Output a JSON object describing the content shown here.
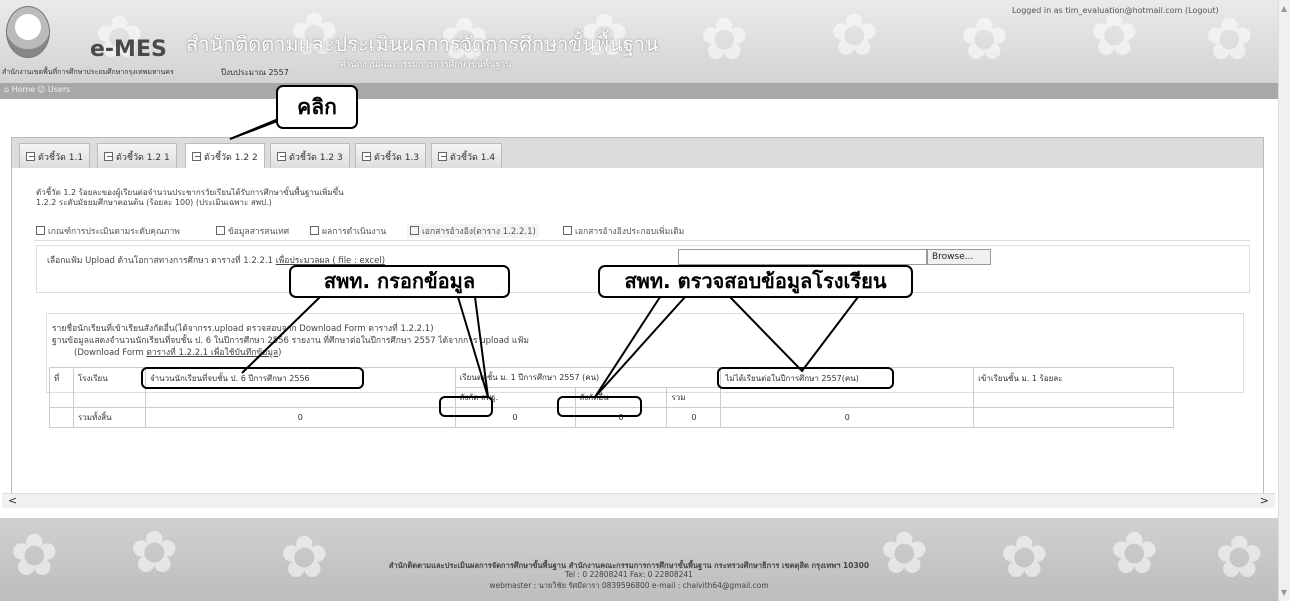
{
  "header": {
    "logo_text": "e-MES",
    "office_title": "สำนักติดตามและประเมินผลการจัดการศึกษาขั้นพื้นฐาน",
    "office_subtitle": "สำนักงานคณะกรรมการการศึกษาขั้นพื้นฐาน",
    "agency": "สำนักงานเขตพื้นที่การศึกษาประถมศึกษากรุงเทพมหานคร",
    "budget_year": "ปีงบประมาณ 2557",
    "logged_in": "Logged in as tim_evaluation@hotmail.com (Logout)"
  },
  "nav": {
    "home": "Home",
    "users": "Users"
  },
  "tabs": [
    "ตัวชี้วัด 1.1",
    "ตัวชี้วัด 1.2 1",
    "ตัวชี้วัด 1.2 2",
    "ตัวชี้วัด 1.2 3",
    "ตัวชี้วัด 1.3",
    "ตัวชี้วัด 1.4"
  ],
  "indicator": {
    "line1": "ตัวชี้วัด 1.2 ร้อยละของผู้เรียนต่อจำนวนประชากรวัยเรียนได้รับการศึกษาขั้นพื้นฐานเพิ่มขึ้น",
    "line2": "1.2.2 ระดับมัธยมศึกษาตอนต้น (ร้อยละ 100) (ประเมินเฉพาะ สพป.)"
  },
  "subtabs": [
    "เกณฑ์การประเมินตามระดับคุณภาพ",
    "ข้อมูลสารสนเทศ",
    "ผลการดำเนินงาน",
    "เอกสารอ้างอิง(ตาราง 1.2.2.1)",
    "เอกสารอ้างอิงประกอบเพิ่มเติม"
  ],
  "upload": {
    "label": "เลือกแฟ้ม Upload ด้านโอกาสทางการศึกษา ตารางที่ 1.2.2.1",
    "link": "เพื่อประมวลผล ( file : excel)",
    "browse": "Browse..."
  },
  "info": {
    "line1": "รายชื่อนักเรียนที่เข้าเรียนสังกัดอื่น(ได้จากรร.upload ตรวจสอบจาก Download Form ตารางที่ 1.2.2.1)",
    "line2": "ฐานข้อมูลแสดงจำนวนนักเรียนที่จบชั้น ป. 6 ในปีการศึกษา 2556 รายงาน ที่ศึกษาต่อในปีการศึกษา 2557 ได้จากการ upload แฟ้ม",
    "line3_prefix": "(Download Form ",
    "line3_link": "ตารางที่ 1.2.2.1 เพื่อใช้บันทึกข้อมูล",
    "line3_suffix": ")"
  },
  "table": {
    "h_no": "ที่",
    "h_school": "โรงเรียน",
    "h_grad": "จำนวนนักเรียนที่จบชั้น ป. 6 ปีการศึกษา 2556",
    "h_cont": "เรียนต่อชั้น ม. 1 ปีการศึกษา 2557 (คน)",
    "h_notcont": "ไม่ได้เรียนต่อในปีการศึกษา 2557(คน)",
    "h_pct": "เข้าเรียนชั้น ม. 1 ร้อยละ",
    "h_obec": "สังกัด สพฐ.",
    "h_other": "สังกัดอื่น",
    "h_sum": "รวม",
    "total_label": "รวมทั้งสิ้น",
    "total_grad": "0",
    "total_obec": "0",
    "total_other": "0",
    "total_sum": "0",
    "total_notcont": "0"
  },
  "footer": {
    "line1": "สำนักติดตามและประเมินผลการจัดการศึกษาขั้นพื้นฐาน สำนักงานคณะกรรมการการศึกษาขั้นพื้นฐาน กระทรวงศึกษาธิการ เขตดุสิต กรุงเทพฯ 10300",
    "line2": "Tel : 0 22808241 Fax: 0 22808241",
    "line3": "webmaster : นายวิชัย รัศมีดารา 0839596800 e-mail : chaivith64@gmail.com"
  },
  "callouts": {
    "click": "คลิก",
    "fill": "สพท. กรอกข้อมูล",
    "check": "สพท. ตรวจสอบข้อมูลโรงเรียน"
  }
}
